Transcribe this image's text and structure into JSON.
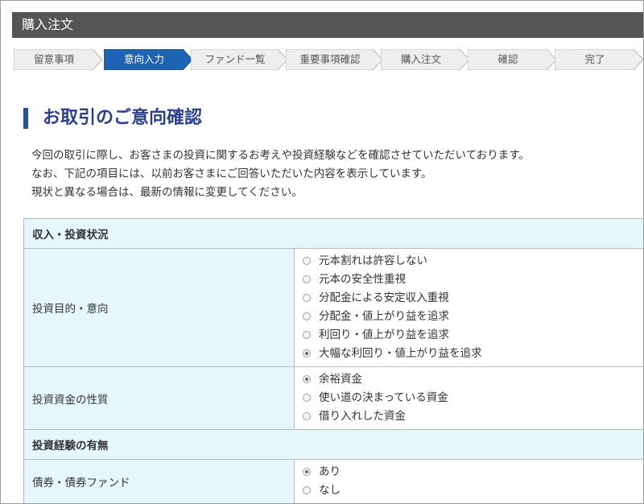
{
  "window": {
    "title": "購入注文"
  },
  "steps": [
    {
      "label": "留意事項",
      "active": false
    },
    {
      "label": "意向入力",
      "active": true
    },
    {
      "label": "ファンド一覧",
      "active": false
    },
    {
      "label": "重要事項確認",
      "active": false
    },
    {
      "label": "購入注文",
      "active": false
    },
    {
      "label": "確認",
      "active": false
    },
    {
      "label": "完了",
      "active": false
    }
  ],
  "page": {
    "heading": "お取引のご意向確認",
    "intro": [
      "今回の取引に際し、お客さまの投資に関するお考えや投資経験などを確認させていただいております。",
      "なお、下記の項目には、以前お客さまにご回答いただいた内容を表示しています。",
      "現状と異なる場合は、最新の情報に変更してください。"
    ]
  },
  "colors": {
    "titlebar": "#555555",
    "step_active": "#1f63b4",
    "step_inactive": "#eeeeee",
    "heading": "#2a3f8f",
    "section_bg": "#e6f7fb"
  },
  "sections": [
    {
      "title": "収入・投資状況",
      "questions": [
        {
          "label": "投資目的・意向",
          "options": [
            {
              "label": "元本割れは許容しない",
              "selected": false
            },
            {
              "label": "元本の安全性重視",
              "selected": false
            },
            {
              "label": "分配金による安定収入重視",
              "selected": false
            },
            {
              "label": "分配金・値上がり益を追求",
              "selected": false
            },
            {
              "label": "利回り・値上がり益を追求",
              "selected": false
            },
            {
              "label": "大幅な利回り・値上がり益を追求",
              "selected": true
            }
          ]
        },
        {
          "label": "投資資金の性質",
          "options": [
            {
              "label": "余裕資金",
              "selected": true
            },
            {
              "label": "使い道の決まっている資金",
              "selected": false
            },
            {
              "label": "借り入れした資金",
              "selected": false
            }
          ]
        }
      ]
    },
    {
      "title": "投資経験の有無",
      "questions": [
        {
          "label": "債券・債券ファンド",
          "options": [
            {
              "label": "あり",
              "selected": true
            },
            {
              "label": "なし",
              "selected": false
            }
          ]
        }
      ]
    }
  ]
}
